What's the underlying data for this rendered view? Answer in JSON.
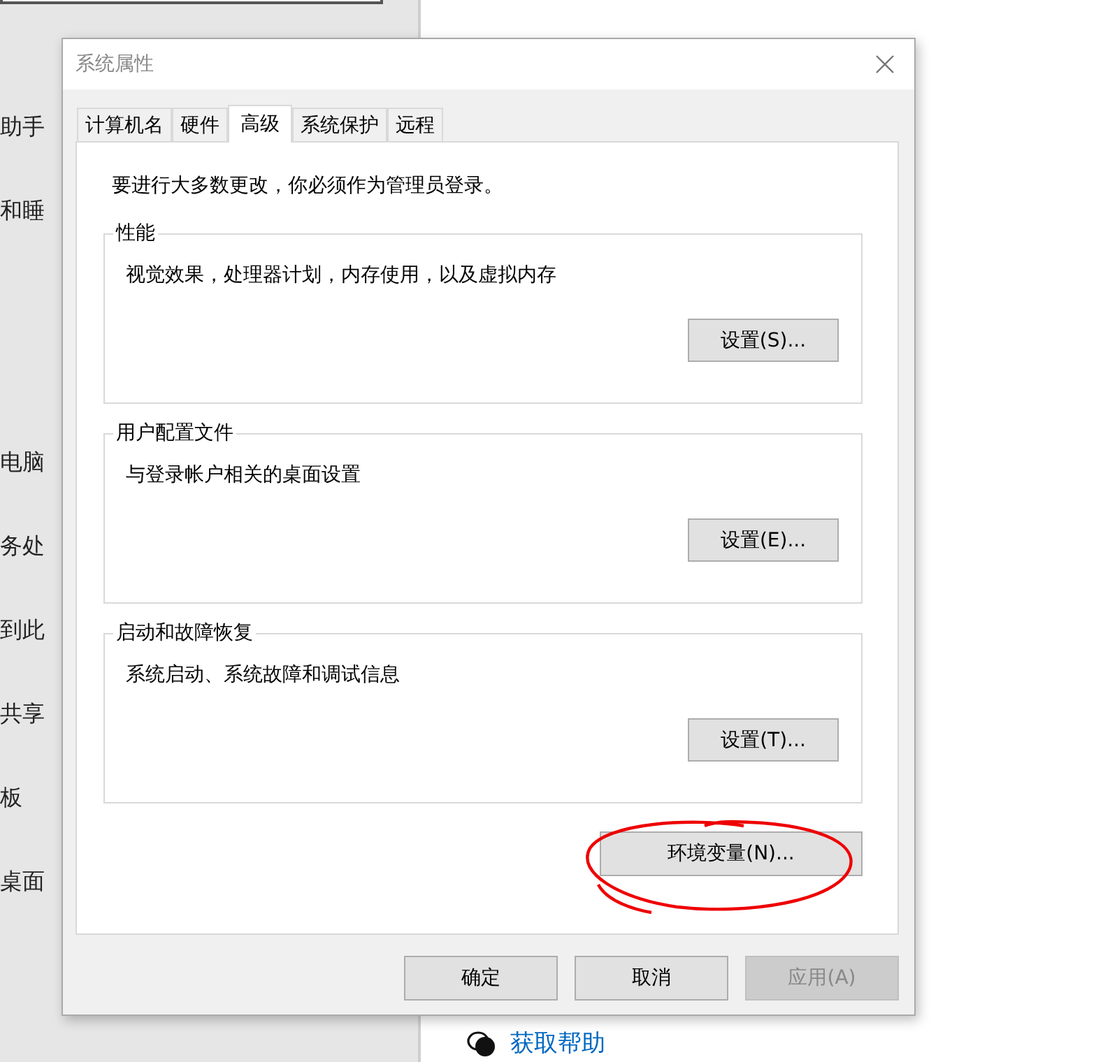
{
  "background": {
    "sidebar_items": [
      "助手",
      "和睡",
      "电脑",
      "务处",
      "到此",
      "共享",
      "板",
      "桌面"
    ],
    "help_link": "获取帮助"
  },
  "dialog": {
    "title": "系统属性",
    "tabs": [
      {
        "label": "计算机名",
        "selected": false
      },
      {
        "label": "硬件",
        "selected": false
      },
      {
        "label": "高级",
        "selected": true
      },
      {
        "label": "系统保护",
        "selected": false
      },
      {
        "label": "远程",
        "selected": false
      }
    ],
    "notice": "要进行大多数更改，你必须作为管理员登录。",
    "groups": [
      {
        "title": "性能",
        "description": "视觉效果，处理器计划，内存使用，以及虚拟内存",
        "button": "设置(S)..."
      },
      {
        "title": "用户配置文件",
        "description": "与登录帐户相关的桌面设置",
        "button": "设置(E)..."
      },
      {
        "title": "启动和故障恢复",
        "description": "系统启动、系统故障和调试信息",
        "button": "设置(T)..."
      }
    ],
    "env_button": "环境变量(N)...",
    "buttons": [
      {
        "label": "确定",
        "disabled": false
      },
      {
        "label": "取消",
        "disabled": false
      },
      {
        "label": "应用(A)",
        "disabled": true
      }
    ]
  }
}
